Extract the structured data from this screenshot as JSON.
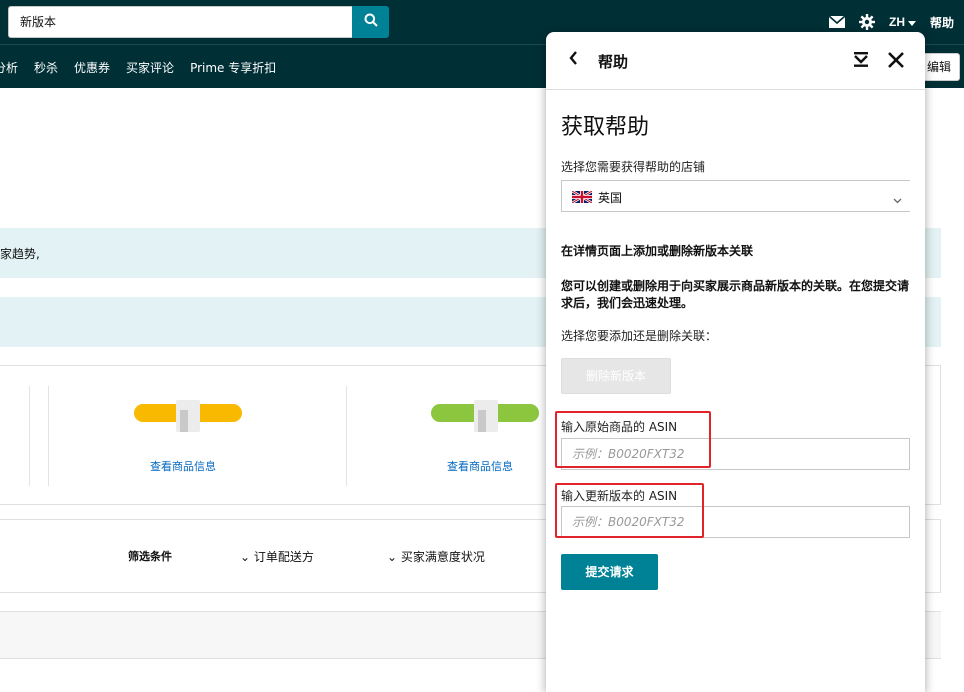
{
  "search": {
    "value": "新版本"
  },
  "top_right": {
    "language": "ZH",
    "help_label": "帮助"
  },
  "nav": {
    "items": [
      "分析",
      "秒杀",
      "优惠券",
      "买家评论",
      "Prime 专享折扣"
    ],
    "right_button": "编辑"
  },
  "page": {
    "banner_text": "家趋势,",
    "cards": [
      {
        "link": "查看商品信息"
      },
      {
        "link": "查看商品信息"
      }
    ],
    "filters": {
      "label": "筛选条件",
      "items": [
        "订单配送方",
        "买家满意度状况"
      ]
    }
  },
  "help_panel": {
    "title": "帮助",
    "heading": "获取帮助",
    "store_label": "选择您需要获得帮助的店铺",
    "store_value": "英国",
    "section_title": "在详情页面上添加或删除新版本关联",
    "section_desc": "您可以创建或删除用于向买家展示商品新版本的关联。在您提交请求后，我们会迅速处理。",
    "choose_label": "选择您要添加还是删除关联：",
    "remove_button": "删除新版本",
    "original_asin_label": "输入原始商品的 ASIN",
    "original_asin_placeholder": "示例：B0020FXT32",
    "new_asin_label": "输入更新版本的 ASIN",
    "new_asin_placeholder": "示例：B0020FXT32",
    "submit_button": "提交请求"
  },
  "colors": {
    "header_bg": "#002f36",
    "accent": "#008296",
    "banner_bg": "#e3f2f4",
    "highlight": "#e0242a"
  }
}
